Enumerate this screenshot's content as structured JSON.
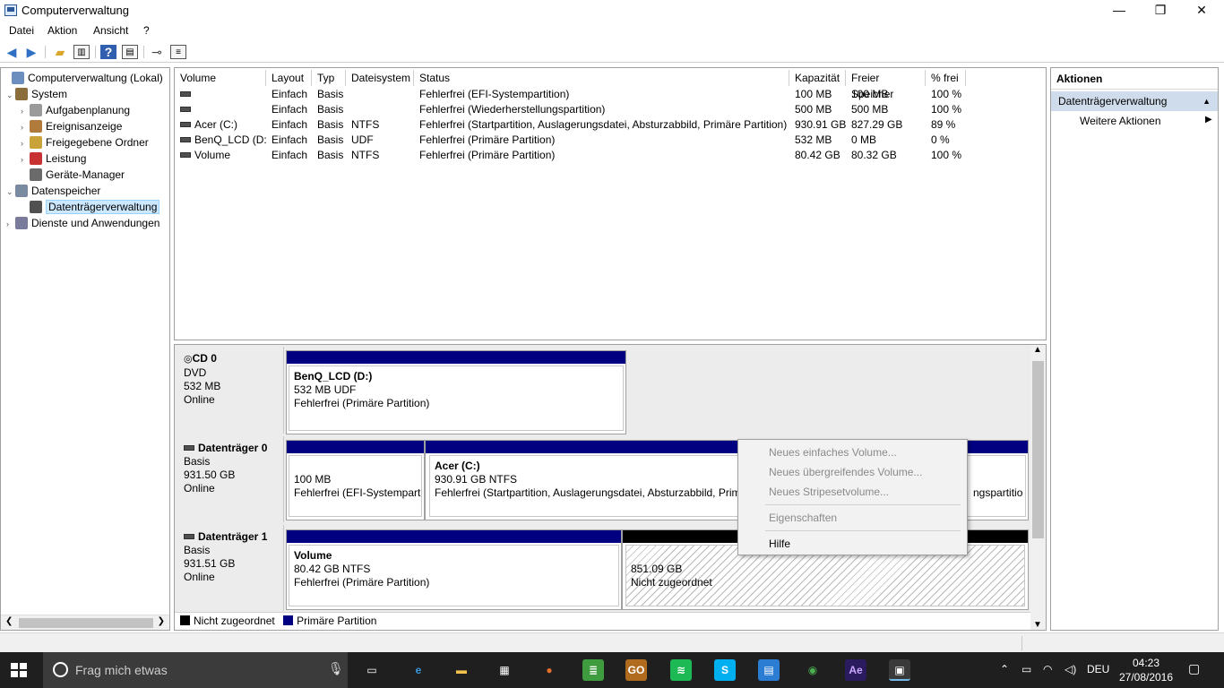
{
  "window": {
    "title": "Computerverwaltung"
  },
  "menu": [
    "Datei",
    "Aktion",
    "Ansicht",
    "?"
  ],
  "tree": [
    {
      "label": "Computerverwaltung (Lokal)",
      "level": 0,
      "expander": "",
      "icon": "computer-management-icon",
      "color": "#6b8ebf"
    },
    {
      "label": "System",
      "level": 1,
      "expander": "⌄",
      "icon": "system-tools-icon",
      "color": "#8a6d3b"
    },
    {
      "label": "Aufgabenplanung",
      "level": 2,
      "expander": "›",
      "icon": "clock-icon",
      "color": "#9a9a9a"
    },
    {
      "label": "Ereignisanzeige",
      "level": 2,
      "expander": "›",
      "icon": "event-viewer-icon",
      "color": "#b07a3a"
    },
    {
      "label": "Freigegebene Ordner",
      "level": 2,
      "expander": "›",
      "icon": "shared-folder-icon",
      "color": "#c9a23a"
    },
    {
      "label": "Leistung",
      "level": 2,
      "expander": "›",
      "icon": "performance-icon",
      "color": "#c83232"
    },
    {
      "label": "Geräte-Manager",
      "level": 2,
      "expander": "",
      "icon": "device-manager-icon",
      "color": "#6a6a6a"
    },
    {
      "label": "Datenspeicher",
      "level": 1,
      "expander": "⌄",
      "icon": "storage-icon",
      "color": "#7a8aa0"
    },
    {
      "label": "Datenträgerverwaltung",
      "level": 2,
      "expander": "",
      "icon": "disk-management-icon",
      "color": "#505050",
      "selected": true
    },
    {
      "label": "Dienste und Anwendungen",
      "level": 1,
      "expander": "›",
      "icon": "services-icon",
      "color": "#7a7a9a"
    }
  ],
  "volumes": {
    "columns": [
      "Volume",
      "Layout",
      "Typ",
      "Dateisystem",
      "Status",
      "Kapazität",
      "Freier Speicher",
      "% frei"
    ],
    "rows": [
      [
        "",
        "Einfach",
        "Basis",
        "",
        "Fehlerfrei (EFI-Systempartition)",
        "100 MB",
        "100 MB",
        "100 %"
      ],
      [
        "",
        "Einfach",
        "Basis",
        "",
        "Fehlerfrei (Wiederherstellungspartition)",
        "500 MB",
        "500 MB",
        "100 %"
      ],
      [
        "Acer (C:)",
        "Einfach",
        "Basis",
        "NTFS",
        "Fehlerfrei (Startpartition, Auslagerungsdatei, Absturzabbild, Primäre Partition)",
        "930.91 GB",
        "827.29 GB",
        "89 %"
      ],
      [
        "BenQ_LCD (D:)",
        "Einfach",
        "Basis",
        "UDF",
        "Fehlerfrei (Primäre Partition)",
        "532 MB",
        "0 MB",
        "0 %"
      ],
      [
        "Volume",
        "Einfach",
        "Basis",
        "NTFS",
        "Fehlerfrei (Primäre Partition)",
        "80.42 GB",
        "80.32 GB",
        "100 %"
      ]
    ]
  },
  "disks": {
    "cd0": {
      "name": "CD 0",
      "type": "DVD",
      "size": "532 MB",
      "state": "Online",
      "partition": {
        "name": "BenQ_LCD  (D:)",
        "size": "532 MB UDF",
        "status": "Fehlerfrei (Primäre Partition)"
      }
    },
    "disk0": {
      "name": "Datenträger 0",
      "type": "Basis",
      "size": "931.50 GB",
      "state": "Online",
      "p1": {
        "size": "100 MB",
        "status": "Fehlerfrei (EFI-Systempartition)"
      },
      "p2": {
        "name": "Acer  (C:)",
        "size": "930.91 GB NTFS",
        "status": "Fehlerfrei (Startpartition, Auslagerungsdatei, Absturzabbild, Primäre Partition)"
      },
      "p3": {
        "status_tail": "ngspartitio"
      }
    },
    "disk1": {
      "name": "Datenträger 1",
      "type": "Basis",
      "size": "931.51 GB",
      "state": "Online",
      "p1": {
        "name": "Volume",
        "size": "80.42 GB NTFS",
        "status": "Fehlerfrei (Primäre Partition)"
      },
      "p2": {
        "size": "851.09 GB",
        "status": "Nicht zugeordnet"
      }
    }
  },
  "legend": {
    "unallocated": "Nicht zugeordnet",
    "primary": "Primäre Partition"
  },
  "actions": {
    "header": "Aktionen",
    "section": "Datenträgerverwaltung",
    "more": "Weitere Aktionen"
  },
  "context_menu": {
    "new_simple": "Neues einfaches Volume...",
    "new_spanned": "Neues übergreifendes Volume...",
    "new_striped": "Neues Stripesetvolume...",
    "properties": "Eigenschaften",
    "help": "Hilfe"
  },
  "taskbar": {
    "search_placeholder": "Frag mich etwas",
    "language": "DEU",
    "time": "04:23",
    "date": "27/08/2016",
    "apps": [
      {
        "icon": "task-view-icon",
        "glyph": "▭",
        "bg": "#1f1f1f"
      },
      {
        "icon": "edge-icon",
        "glyph": "e",
        "bg": "#1f1f1f",
        "fg": "#3a96dd"
      },
      {
        "icon": "file-explorer-icon",
        "glyph": "▬",
        "bg": "#1f1f1f",
        "fg": "#f2c14e"
      },
      {
        "icon": "store-icon",
        "glyph": "▦",
        "bg": "#1f1f1f"
      },
      {
        "icon": "firefox-icon",
        "glyph": "●",
        "bg": "#1f1f1f",
        "fg": "#e76f2b"
      },
      {
        "icon": "notes-icon",
        "glyph": "≣",
        "bg": "#3e9b3e"
      },
      {
        "icon": "csgo-icon",
        "glyph": "GO",
        "bg": "#b06b1f"
      },
      {
        "icon": "spotify-icon",
        "glyph": "≋",
        "bg": "#1db954"
      },
      {
        "icon": "skype-icon",
        "glyph": "S",
        "bg": "#00aff0"
      },
      {
        "icon": "outlook-icon",
        "glyph": "▤",
        "bg": "#2b7cd3"
      },
      {
        "icon": "chrome-icon",
        "glyph": "◉",
        "bg": "#1f1f1f",
        "fg": "#4caf50"
      },
      {
        "icon": "after-effects-icon",
        "glyph": "Ae",
        "bg": "#2a1a5e",
        "fg": "#c9a7ff"
      },
      {
        "icon": "computer-management-icon",
        "glyph": "▣",
        "bg": "#3a3a3a",
        "active": true
      }
    ]
  },
  "colors": {
    "primary_partition": "#000080",
    "unallocated": "#000000",
    "selection": "#cce8ff",
    "actions_section": "#cfdcec"
  }
}
